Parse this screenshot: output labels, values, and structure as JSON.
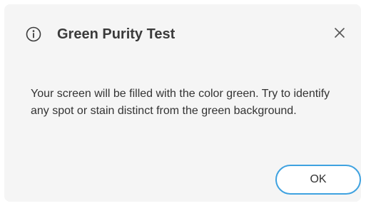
{
  "dialog": {
    "title": "Green Purity Test",
    "message": "Your screen will be filled with the color green. Try to identify any spot or stain distinct from the green background.",
    "ok_label": "OK",
    "icons": {
      "title_icon": "info-icon",
      "close_icon": "close-icon"
    },
    "colors": {
      "background": "#f5f5f5",
      "button_border": "#3fa2e0",
      "text": "#333333"
    }
  }
}
